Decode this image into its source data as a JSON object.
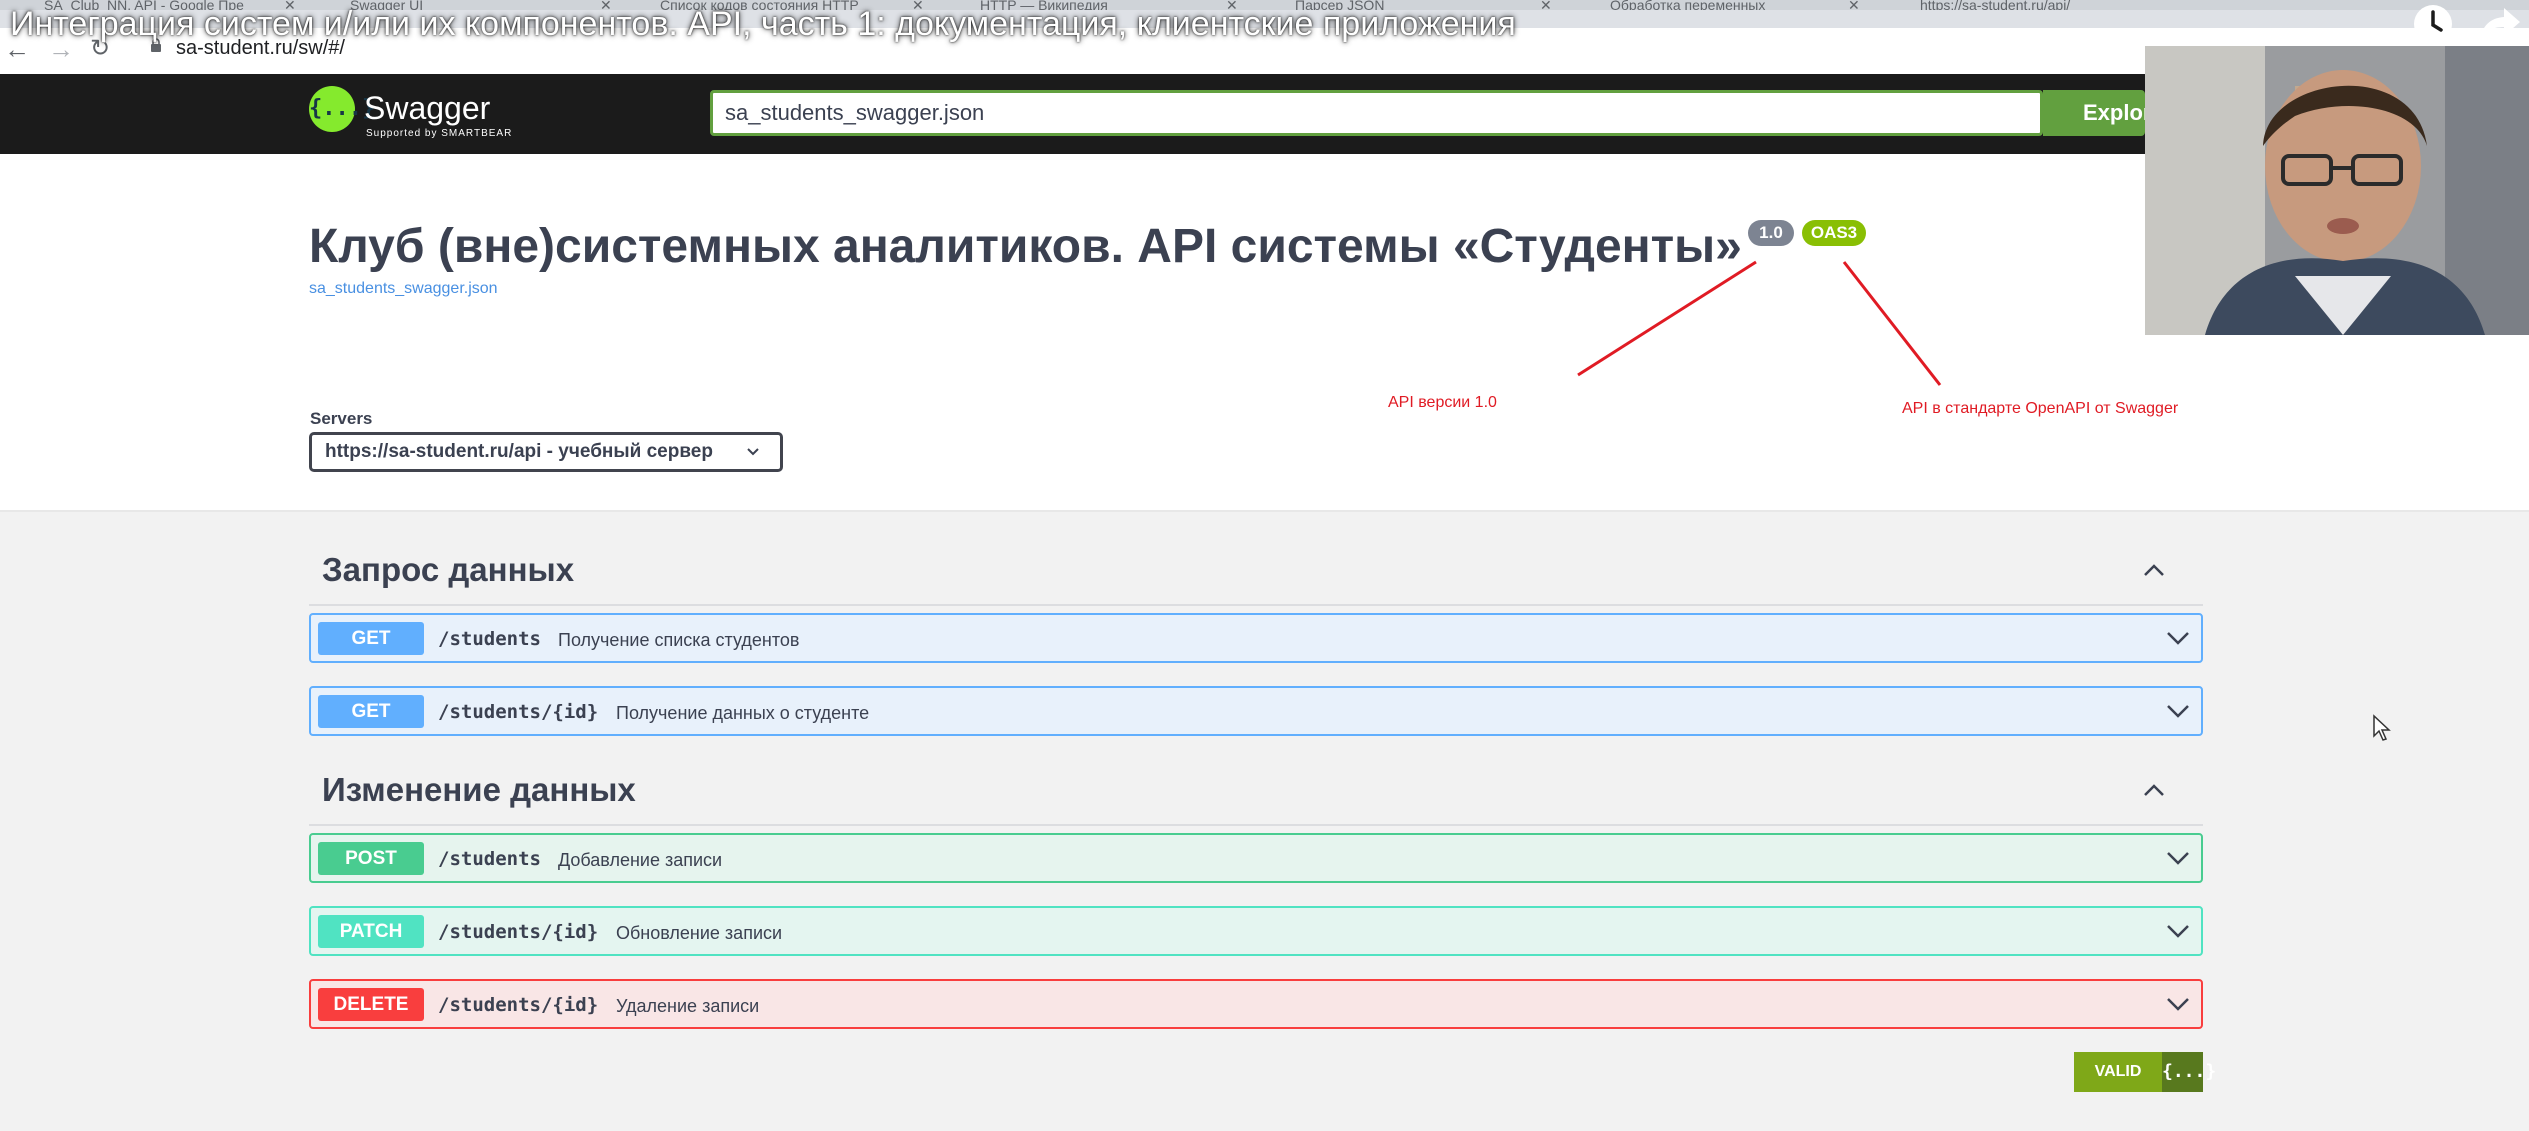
{
  "browser": {
    "tabs": [
      {
        "label": "SA_Club_NN. API - Google Пре"
      },
      {
        "label": "Swagger UI"
      },
      {
        "label": "Список кодов состояния HTTP"
      },
      {
        "label": "HTTP — Википедия"
      },
      {
        "label": "Парсер JSON"
      },
      {
        "label": "Обработка переменных"
      },
      {
        "label": "https://sa-student.ru/api/"
      }
    ],
    "url": "sa-student.ru/sw/#/"
  },
  "video": {
    "title": "Интеграция систем и/или их компонентов. API, часть 1: документация, клиентские приложения",
    "icons": [
      "clock-icon",
      "share-icon"
    ]
  },
  "topbar": {
    "logo_word": "Swagger",
    "logo_sub": "Supported by SMARTBEAR",
    "logo_glyph": "{...}",
    "spec_url": "sa_students_swagger.json",
    "explore_label": "Explore"
  },
  "info": {
    "title": "Клуб (вне)системных аналитиков. API системы «Студенты»",
    "version_badge": "1.0",
    "oas_badge": "OAS3",
    "spec_link": "sa_students_swagger.json"
  },
  "servers": {
    "label": "Servers",
    "selected": "https://sa-student.ru/api - учебный сервер"
  },
  "annotations": {
    "version_note": "API версии 1.0",
    "oas_note": "API в стандарте OpenAPI от Swagger",
    "color": "#e01b24"
  },
  "tags": [
    {
      "name": "Запрос данных",
      "operations": [
        {
          "method": "GET",
          "path": "/students",
          "summary": "Получение списка студентов"
        },
        {
          "method": "GET",
          "path": "/students/{id}",
          "summary": "Получение данных о студенте"
        }
      ]
    },
    {
      "name": "Изменение данных",
      "operations": [
        {
          "method": "POST",
          "path": "/students",
          "summary": "Добавление записи"
        },
        {
          "method": "PATCH",
          "path": "/students/{id}",
          "summary": "Обновление записи"
        },
        {
          "method": "DELETE",
          "path": "/students/{id}",
          "summary": "Удаление записи"
        }
      ]
    }
  ],
  "validator": {
    "label": "VALID",
    "icon_glyph": "{...}"
  },
  "colors": {
    "get": "#61affe",
    "post": "#49cc90",
    "patch": "#50e3c2",
    "delete": "#f93e3e",
    "swagger_green": "#85ea2d",
    "topbar": "#1b1b1b"
  }
}
